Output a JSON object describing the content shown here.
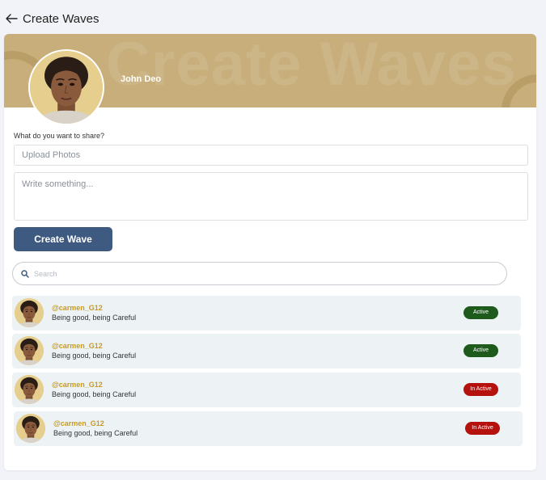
{
  "header": {
    "title": "Create Waves",
    "back_icon": "arrow-left-icon"
  },
  "banner": {
    "watermark": "Create Waves",
    "user_name": "John Deo",
    "color": "#c7ae7b"
  },
  "form": {
    "share_label": "What do you want to share?",
    "upload_placeholder": "Upload Photos",
    "write_placeholder": "Write something...",
    "submit_label": "Create Wave",
    "submit_color": "#3e5a80"
  },
  "search": {
    "placeholder": "Search",
    "icon": "search-icon"
  },
  "waves": [
    {
      "handle": "@carmen_G12",
      "text": "Being good, being Careful",
      "status": "Active"
    },
    {
      "handle": "@carmen_G12",
      "text": "Being good, being Careful",
      "status": "Active"
    },
    {
      "handle": "@carmen_G12",
      "text": "Being good, being Careful",
      "status": "In Active"
    },
    {
      "handle": "@carmen_G12",
      "text": "Being good, being Careful",
      "status": "In Active"
    }
  ],
  "colors": {
    "active": "#1e5a1c",
    "inactive": "#b5120e",
    "handle": "#c99a1e",
    "row_bg": "#edf3f5"
  }
}
